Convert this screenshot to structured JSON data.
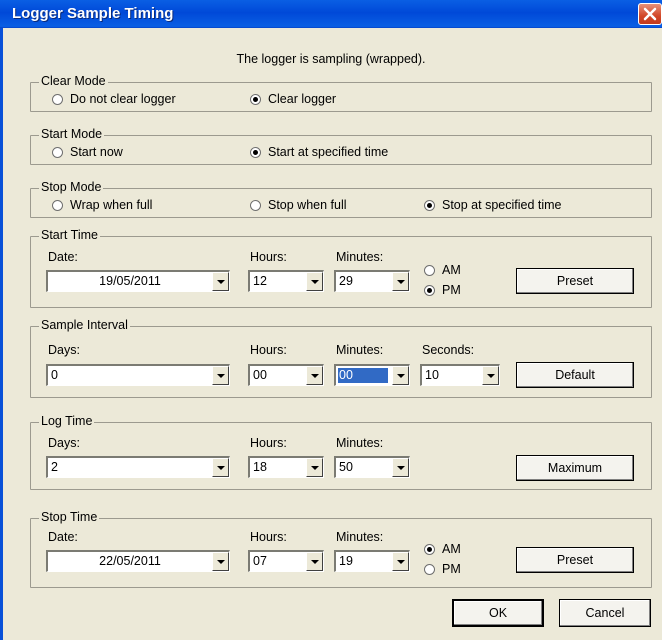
{
  "window": {
    "title": "Logger Sample Timing"
  },
  "status": "The logger is sampling (wrapped).",
  "clear_mode": {
    "legend": "Clear Mode",
    "options": [
      "Do not clear logger",
      "Clear logger"
    ],
    "selected": "Clear logger"
  },
  "start_mode": {
    "legend": "Start Mode",
    "options": [
      "Start now",
      "Start at specified time"
    ],
    "selected": "Start at specified time"
  },
  "stop_mode": {
    "legend": "Stop Mode",
    "options": [
      "Wrap when full",
      "Stop when full",
      "Stop at specified time"
    ],
    "selected": "Stop at specified time"
  },
  "start_time": {
    "legend": "Start Time",
    "date_label": "Date:",
    "date": "19/05/2011",
    "hours_label": "Hours:",
    "hours": "12",
    "minutes_label": "Minutes:",
    "minutes": "29",
    "am": "AM",
    "pm": "PM",
    "selected": "PM",
    "preset_label": "Preset"
  },
  "sample_interval": {
    "legend": "Sample Interval",
    "days_label": "Days:",
    "days": "0",
    "hours_label": "Hours:",
    "hours": "00",
    "minutes_label": "Minutes:",
    "minutes": "00",
    "seconds_label": "Seconds:",
    "seconds": "10",
    "default_label": "Default"
  },
  "log_time": {
    "legend": "Log Time",
    "days_label": "Days:",
    "days": "2",
    "hours_label": "Hours:",
    "hours": "18",
    "minutes_label": "Minutes:",
    "minutes": "50",
    "maximum_label": "Maximum"
  },
  "stop_time": {
    "legend": "Stop Time",
    "date_label": "Date:",
    "date": "22/05/2011",
    "hours_label": "Hours:",
    "hours": "07",
    "minutes_label": "Minutes:",
    "minutes": "19",
    "am": "AM",
    "pm": "PM",
    "selected": "AM",
    "preset_label": "Preset"
  },
  "buttons": {
    "ok": "OK",
    "cancel": "Cancel"
  }
}
